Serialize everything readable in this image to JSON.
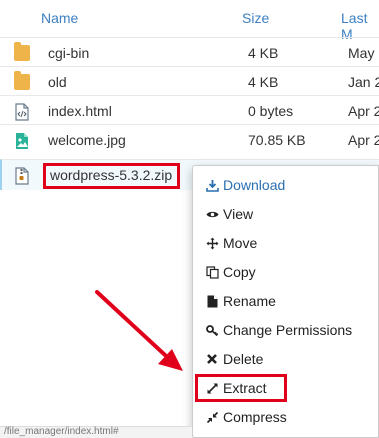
{
  "header": {
    "name_label": "Name",
    "size_label": "Size",
    "modified_label": "Last M"
  },
  "files": [
    {
      "name": "cgi-bin",
      "size": "4 KB",
      "modified": "May",
      "icon": "folder-icon"
    },
    {
      "name": "old",
      "size": "4 KB",
      "modified": "Jan 2",
      "icon": "folder-icon"
    },
    {
      "name": "index.html",
      "size": "0 bytes",
      "modified": "Apr 2",
      "icon": "code-file-icon"
    },
    {
      "name": "welcome.jpg",
      "size": "70.85 KB",
      "modified": "Apr 2",
      "icon": "image-file-icon"
    },
    {
      "name": "wordpress-5.3.2.zip",
      "size": "",
      "modified": "",
      "icon": "zip-file-icon",
      "selected": true
    }
  ],
  "context_menu": {
    "items": [
      {
        "label": "Download",
        "icon": "download-icon"
      },
      {
        "label": "View",
        "icon": "eye-icon"
      },
      {
        "label": "Move",
        "icon": "move-arrows-icon"
      },
      {
        "label": "Copy",
        "icon": "copy-icon"
      },
      {
        "label": "Rename",
        "icon": "file-icon"
      },
      {
        "label": "Change Permissions",
        "icon": "key-icon"
      },
      {
        "label": "Delete",
        "icon": "x-icon"
      },
      {
        "label": "Extract",
        "icon": "expand-icon"
      },
      {
        "label": "Compress",
        "icon": "compress-icon"
      }
    ]
  },
  "status_bar": {
    "text": "/file_manager/index.html#"
  },
  "colors": {
    "accent": "#3d7fc1",
    "highlight_red": "#e0001b",
    "folder": "#efb449"
  }
}
